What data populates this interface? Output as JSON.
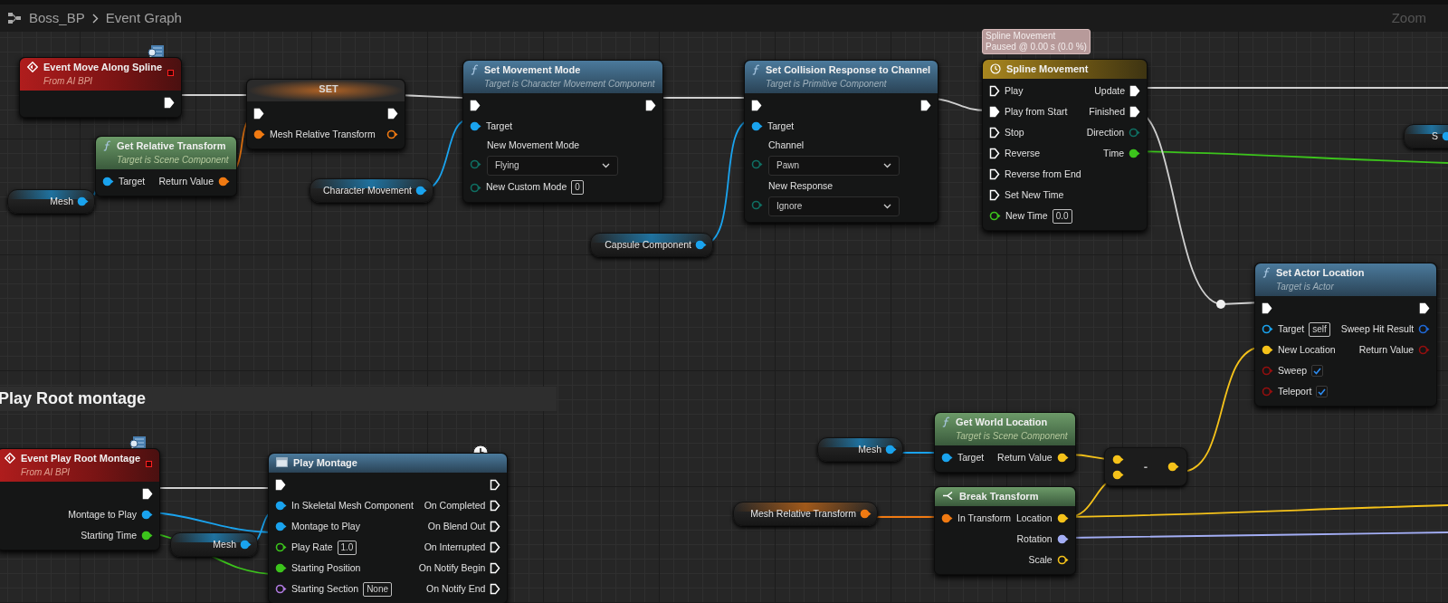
{
  "breadcrumb": {
    "items": [
      "Boss_BP",
      "Event Graph"
    ]
  },
  "zoom_label": "Zoom",
  "comments": [
    {
      "title": "Play Root montage"
    }
  ],
  "nodes": [
    {
      "kind": "event",
      "title": "Event Move Along Spline",
      "subtitle": "From AI BPI",
      "outputs": [
        {
          "kind": "exec",
          "connected": true
        }
      ]
    },
    {
      "kind": "set",
      "title": "SET",
      "inputs": [
        {
          "kind": "exec",
          "connected": true
        },
        {
          "kind": "struct",
          "label": "Mesh Relative Transform",
          "connected": true
        }
      ],
      "outputs": [
        {
          "kind": "exec",
          "connected": true
        },
        {
          "kind": "struct",
          "connected": false
        }
      ]
    },
    {
      "kind": "pure",
      "title": "Get Relative Transform",
      "subtitle": "Target is Scene Component",
      "inputs": [
        {
          "kind": "object",
          "label": "Target",
          "connected": true
        }
      ],
      "outputs": [
        {
          "kind": "struct",
          "label": "Return Value",
          "connected": true
        }
      ]
    },
    {
      "kind": "variable",
      "title": "Mesh",
      "outputs": [
        {
          "kind": "object",
          "connected": true
        }
      ]
    },
    {
      "kind": "variable",
      "title": "Character Movement",
      "outputs": [
        {
          "kind": "object",
          "connected": true
        }
      ]
    },
    {
      "kind": "function",
      "title": "Set Movement Mode",
      "subtitle": "Target is Character Movement Component",
      "inputs": [
        {
          "kind": "exec",
          "connected": true
        },
        {
          "kind": "object",
          "label": "Target",
          "connected": true
        },
        {
          "kind": "enum",
          "label": "New Movement Mode",
          "dropdown": "Flying",
          "connected": false
        },
        {
          "kind": "enum",
          "label": "New Custom Mode",
          "value": "0",
          "connected": false
        }
      ],
      "outputs": [
        {
          "kind": "exec",
          "connected": true
        }
      ]
    },
    {
      "kind": "variable",
      "title": "Capsule Component",
      "outputs": [
        {
          "kind": "object",
          "connected": true
        }
      ]
    },
    {
      "kind": "function",
      "title": "Set Collision Response to Channel",
      "subtitle": "Target is Primitive Component",
      "inputs": [
        {
          "kind": "exec",
          "connected": true
        },
        {
          "kind": "object",
          "label": "Target",
          "connected": true
        },
        {
          "kind": "enum",
          "label": "Channel",
          "dropdown": "Pawn",
          "connected": false
        },
        {
          "kind": "enum",
          "label": "New Response",
          "dropdown": "Ignore",
          "connected": false
        }
      ],
      "outputs": [
        {
          "kind": "exec",
          "connected": true
        }
      ]
    },
    {
      "kind": "timeline",
      "title": "Spline Movement",
      "tooltip": [
        "Spline Movement",
        "Paused @ 0.00 s (0.0 %)"
      ],
      "inputs": [
        {
          "kind": "exec",
          "label": "Play",
          "connected": false
        },
        {
          "kind": "exec",
          "label": "Play from Start",
          "connected": true
        },
        {
          "kind": "exec",
          "label": "Stop",
          "connected": false
        },
        {
          "kind": "exec",
          "label": "Reverse",
          "connected": false
        },
        {
          "kind": "exec",
          "label": "Reverse from End",
          "connected": false
        },
        {
          "kind": "exec",
          "label": "Set New Time",
          "connected": false
        },
        {
          "kind": "float",
          "label": "New Time",
          "value": "0.0",
          "connected": false
        }
      ],
      "outputs": [
        {
          "kind": "exec",
          "label": "Update",
          "connected": true
        },
        {
          "kind": "exec",
          "label": "Finished",
          "connected": true
        },
        {
          "kind": "enum",
          "label": "Direction",
          "connected": false
        },
        {
          "kind": "float",
          "label": "Time",
          "connected": true
        }
      ]
    },
    {
      "kind": "variable",
      "title": "S",
      "outputs": [
        {
          "kind": "object",
          "connected": true
        }
      ]
    },
    {
      "kind": "function",
      "title": "Set Actor Location",
      "subtitle": "Target is Actor",
      "inputs": [
        {
          "kind": "exec",
          "connected": true
        },
        {
          "kind": "object",
          "label": "Target",
          "value": "self",
          "connected": false
        },
        {
          "kind": "vector",
          "label": "New Location",
          "connected": true
        },
        {
          "kind": "bool",
          "label": "Sweep",
          "checked": true,
          "connected": false
        },
        {
          "kind": "bool",
          "label": "Teleport",
          "checked": true,
          "connected": false
        }
      ],
      "outputs": [
        {
          "kind": "exec",
          "connected": true
        },
        {
          "kind": "hit",
          "label": "Sweep Hit Result",
          "connected": false
        },
        {
          "kind": "bool",
          "label": "Return Value",
          "connected": false
        }
      ]
    },
    {
      "kind": "event",
      "title": "Event Play Root Montage",
      "subtitle": "From AI BPI",
      "outputs": [
        {
          "kind": "exec",
          "connected": true
        },
        {
          "kind": "object",
          "label": "Montage to Play",
          "connected": true
        },
        {
          "kind": "float",
          "label": "Starting Time",
          "connected": true
        }
      ]
    },
    {
      "kind": "montage",
      "title": "Play Montage",
      "inputs": [
        {
          "kind": "exec",
          "connected": true
        },
        {
          "kind": "object",
          "label": "In Skeletal Mesh Component",
          "connected": true
        },
        {
          "kind": "object",
          "label": "Montage to Play",
          "connected": true
        },
        {
          "kind": "float",
          "label": "Play Rate",
          "value": "1.0",
          "connected": false
        },
        {
          "kind": "float",
          "label": "Starting Position",
          "connected": true
        },
        {
          "kind": "name",
          "label": "Starting Section",
          "value": "None",
          "connected": false
        }
      ],
      "outputs": [
        {
          "kind": "exec",
          "connected": false
        },
        {
          "kind": "exec",
          "label": "On Completed",
          "connected": false
        },
        {
          "kind": "exec",
          "label": "On Blend Out",
          "connected": false
        },
        {
          "kind": "exec",
          "label": "On Interrupted",
          "connected": false
        },
        {
          "kind": "exec",
          "label": "On Notify Begin",
          "connected": false
        },
        {
          "kind": "exec",
          "label": "On Notify End",
          "connected": false
        }
      ]
    },
    {
      "kind": "variable",
      "title": "Mesh",
      "outputs": [
        {
          "kind": "object",
          "connected": true
        }
      ]
    },
    {
      "kind": "variable",
      "title": "Mesh",
      "outputs": [
        {
          "kind": "object",
          "connected": true
        }
      ]
    },
    {
      "kind": "pure",
      "title": "Get World Location",
      "subtitle": "Target is Scene Component",
      "inputs": [
        {
          "kind": "object",
          "label": "Target",
          "connected": true
        }
      ],
      "outputs": [
        {
          "kind": "vector",
          "label": "Return Value",
          "connected": true
        }
      ]
    },
    {
      "kind": "operator",
      "title": "-",
      "inputs": [
        {
          "kind": "vector",
          "connected": true
        },
        {
          "kind": "vector",
          "connected": true
        }
      ],
      "outputs": [
        {
          "kind": "vector",
          "connected": true
        }
      ]
    },
    {
      "kind": "variable",
      "title": "Mesh Relative Transform",
      "outputs": [
        {
          "kind": "struct",
          "connected": true
        }
      ]
    },
    {
      "kind": "break",
      "title": "Break Transform",
      "inputs": [
        {
          "kind": "struct",
          "label": "In Transform",
          "connected": true
        }
      ],
      "outputs": [
        {
          "kind": "vector",
          "label": "Location",
          "connected": true
        },
        {
          "kind": "rotator",
          "label": "Rotation",
          "connected": true
        },
        {
          "kind": "vector",
          "label": "Scale",
          "connected": false
        }
      ]
    }
  ]
}
